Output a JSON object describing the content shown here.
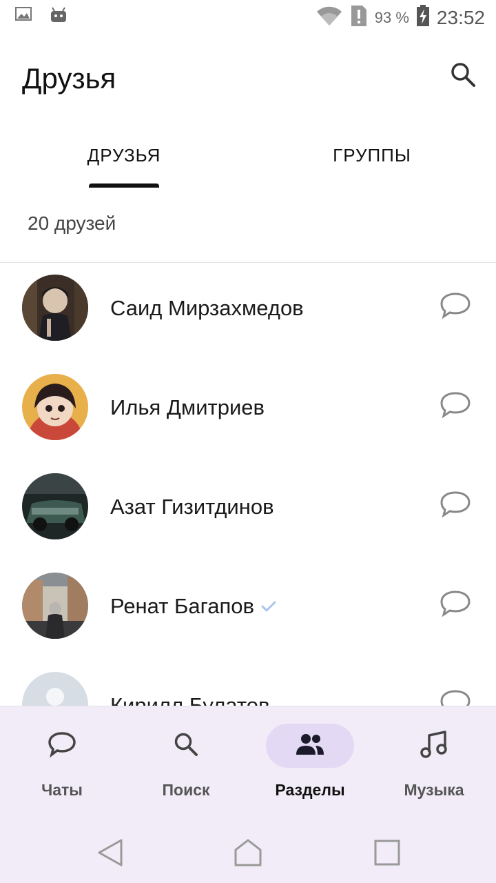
{
  "status_bar": {
    "battery": "93 %",
    "time": "23:52"
  },
  "header": {
    "title": "Друзья"
  },
  "tabs": [
    {
      "label": "ДРУЗЬЯ",
      "active": true
    },
    {
      "label": "ГРУППЫ",
      "active": false
    }
  ],
  "friends_count": "20 друзей",
  "friends": [
    {
      "name": "Саид Мирзахмедов",
      "verified": false
    },
    {
      "name": "Илья Дмитриев",
      "verified": false
    },
    {
      "name": "Азат Гизитдинов",
      "verified": false
    },
    {
      "name": "Ренат Багапов",
      "verified": true
    },
    {
      "name": "Кирилл Булатов",
      "verified": false
    }
  ],
  "bottom_nav": [
    {
      "label": "Чаты",
      "icon": "chat-bubble-icon",
      "active": false
    },
    {
      "label": "Поиск",
      "icon": "search-icon",
      "active": false
    },
    {
      "label": "Разделы",
      "icon": "people-icon",
      "active": true
    },
    {
      "label": "Музыка",
      "icon": "music-note-icon",
      "active": false
    }
  ],
  "colors": {
    "accent_pill": "#e3d9f5",
    "nav_background": "#f1ecf7",
    "verified": "#a8c6e8"
  }
}
